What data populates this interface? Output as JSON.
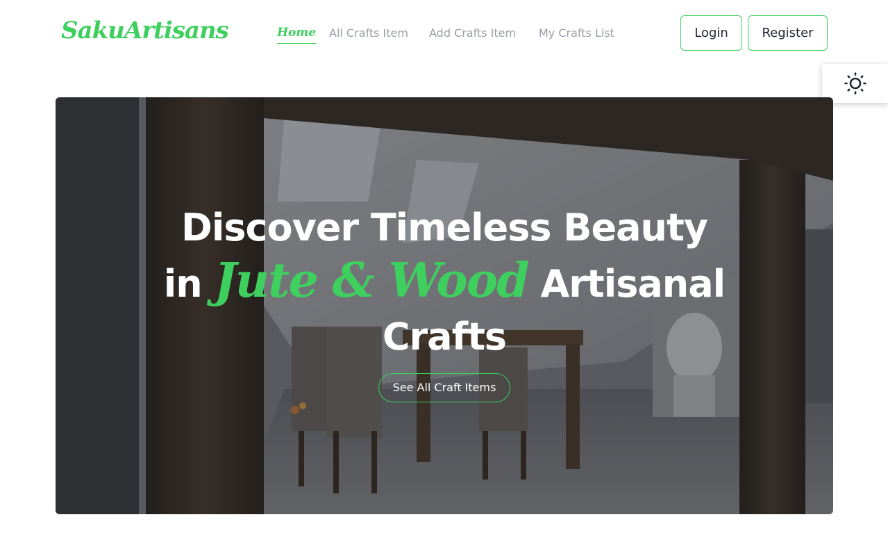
{
  "brand": {
    "name": "SakuArtisans",
    "accent_color": "#3ecf5e"
  },
  "nav": {
    "links": [
      {
        "label": "Home",
        "active": true
      },
      {
        "label": "All Crafts Item",
        "active": false
      },
      {
        "label": "Add Crafts Item",
        "active": false
      },
      {
        "label": "My Crafts List",
        "active": false
      }
    ]
  },
  "auth": {
    "login_label": "Login",
    "register_label": "Register"
  },
  "theme_toggle": {
    "icon": "sun-icon"
  },
  "hero": {
    "title_line1": "Discover Timeless Beauty",
    "title_in": "in",
    "title_accent": "Jute & Wood",
    "title_rest": "Artisanal",
    "title_line3": "Crafts",
    "cta_label": "See All Craft Items"
  }
}
